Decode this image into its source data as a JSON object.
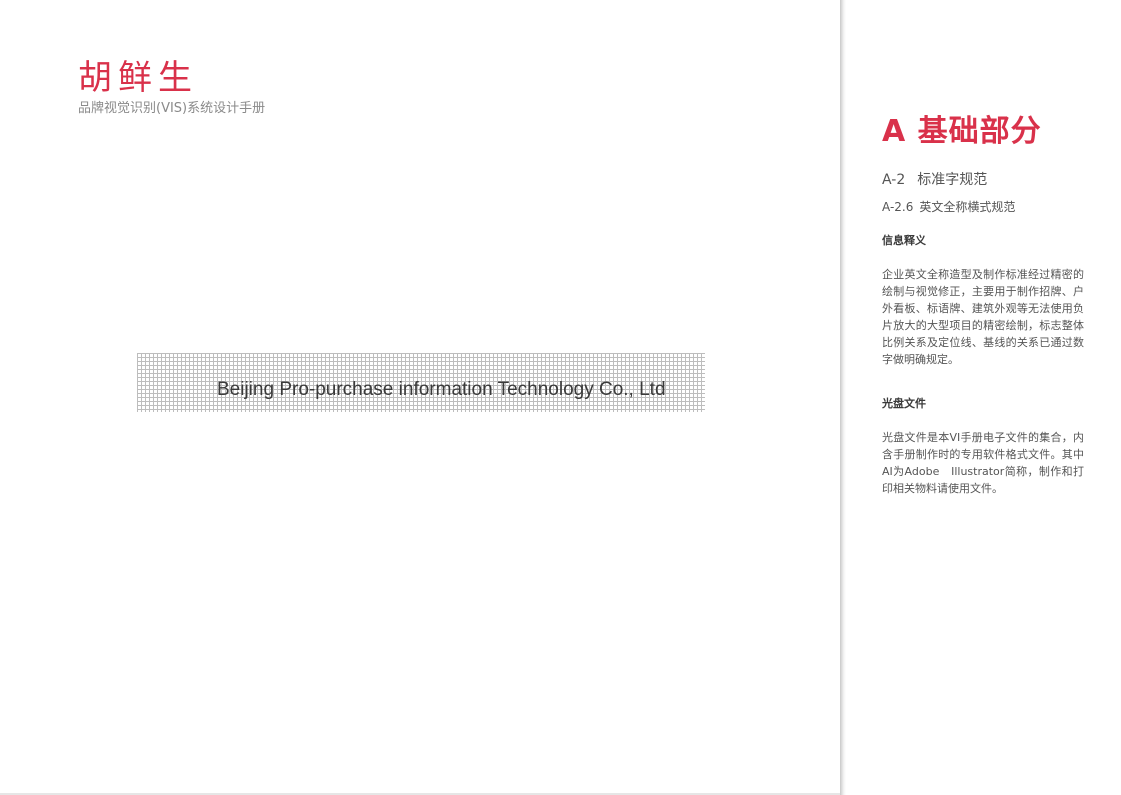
{
  "left_page": {
    "brand_title": "胡鲜生",
    "brand_subtitle": "品牌视觉识别(VIS)系统设计手册",
    "grid_text": "Beijing Pro-purchase information Technology Co., Ltd"
  },
  "right_page": {
    "section_title": "A 基础部分",
    "subsection": {
      "code": "A-2",
      "title": "标准字规范"
    },
    "subsubsection": {
      "code": "A-2.6",
      "title": "英文全称横式规范"
    },
    "blocks": [
      {
        "heading": "信息释义",
        "body": "企业英文全称造型及制作标准经过精密的绘制与视觉修正，主要用于制作招牌、户外看板、标语牌、建筑外观等无法使用负片放大的大型项目的精密绘制，标志整体比例关系及定位线、基线的关系已通过数字做明确规定。"
      },
      {
        "heading": "光盘文件",
        "body": "光盘文件是本VI手册电子文件的集合，内含手册制作时的专用软件格式文件。其中AI为Adobe　Illustrator简称，制作和打印相关物料请使用文件。"
      }
    ]
  },
  "colors": {
    "accent": "#d9314a",
    "subtitle_gray": "#8a8a8a",
    "body_gray": "#555555",
    "grid_line": "#bdbdbd"
  }
}
